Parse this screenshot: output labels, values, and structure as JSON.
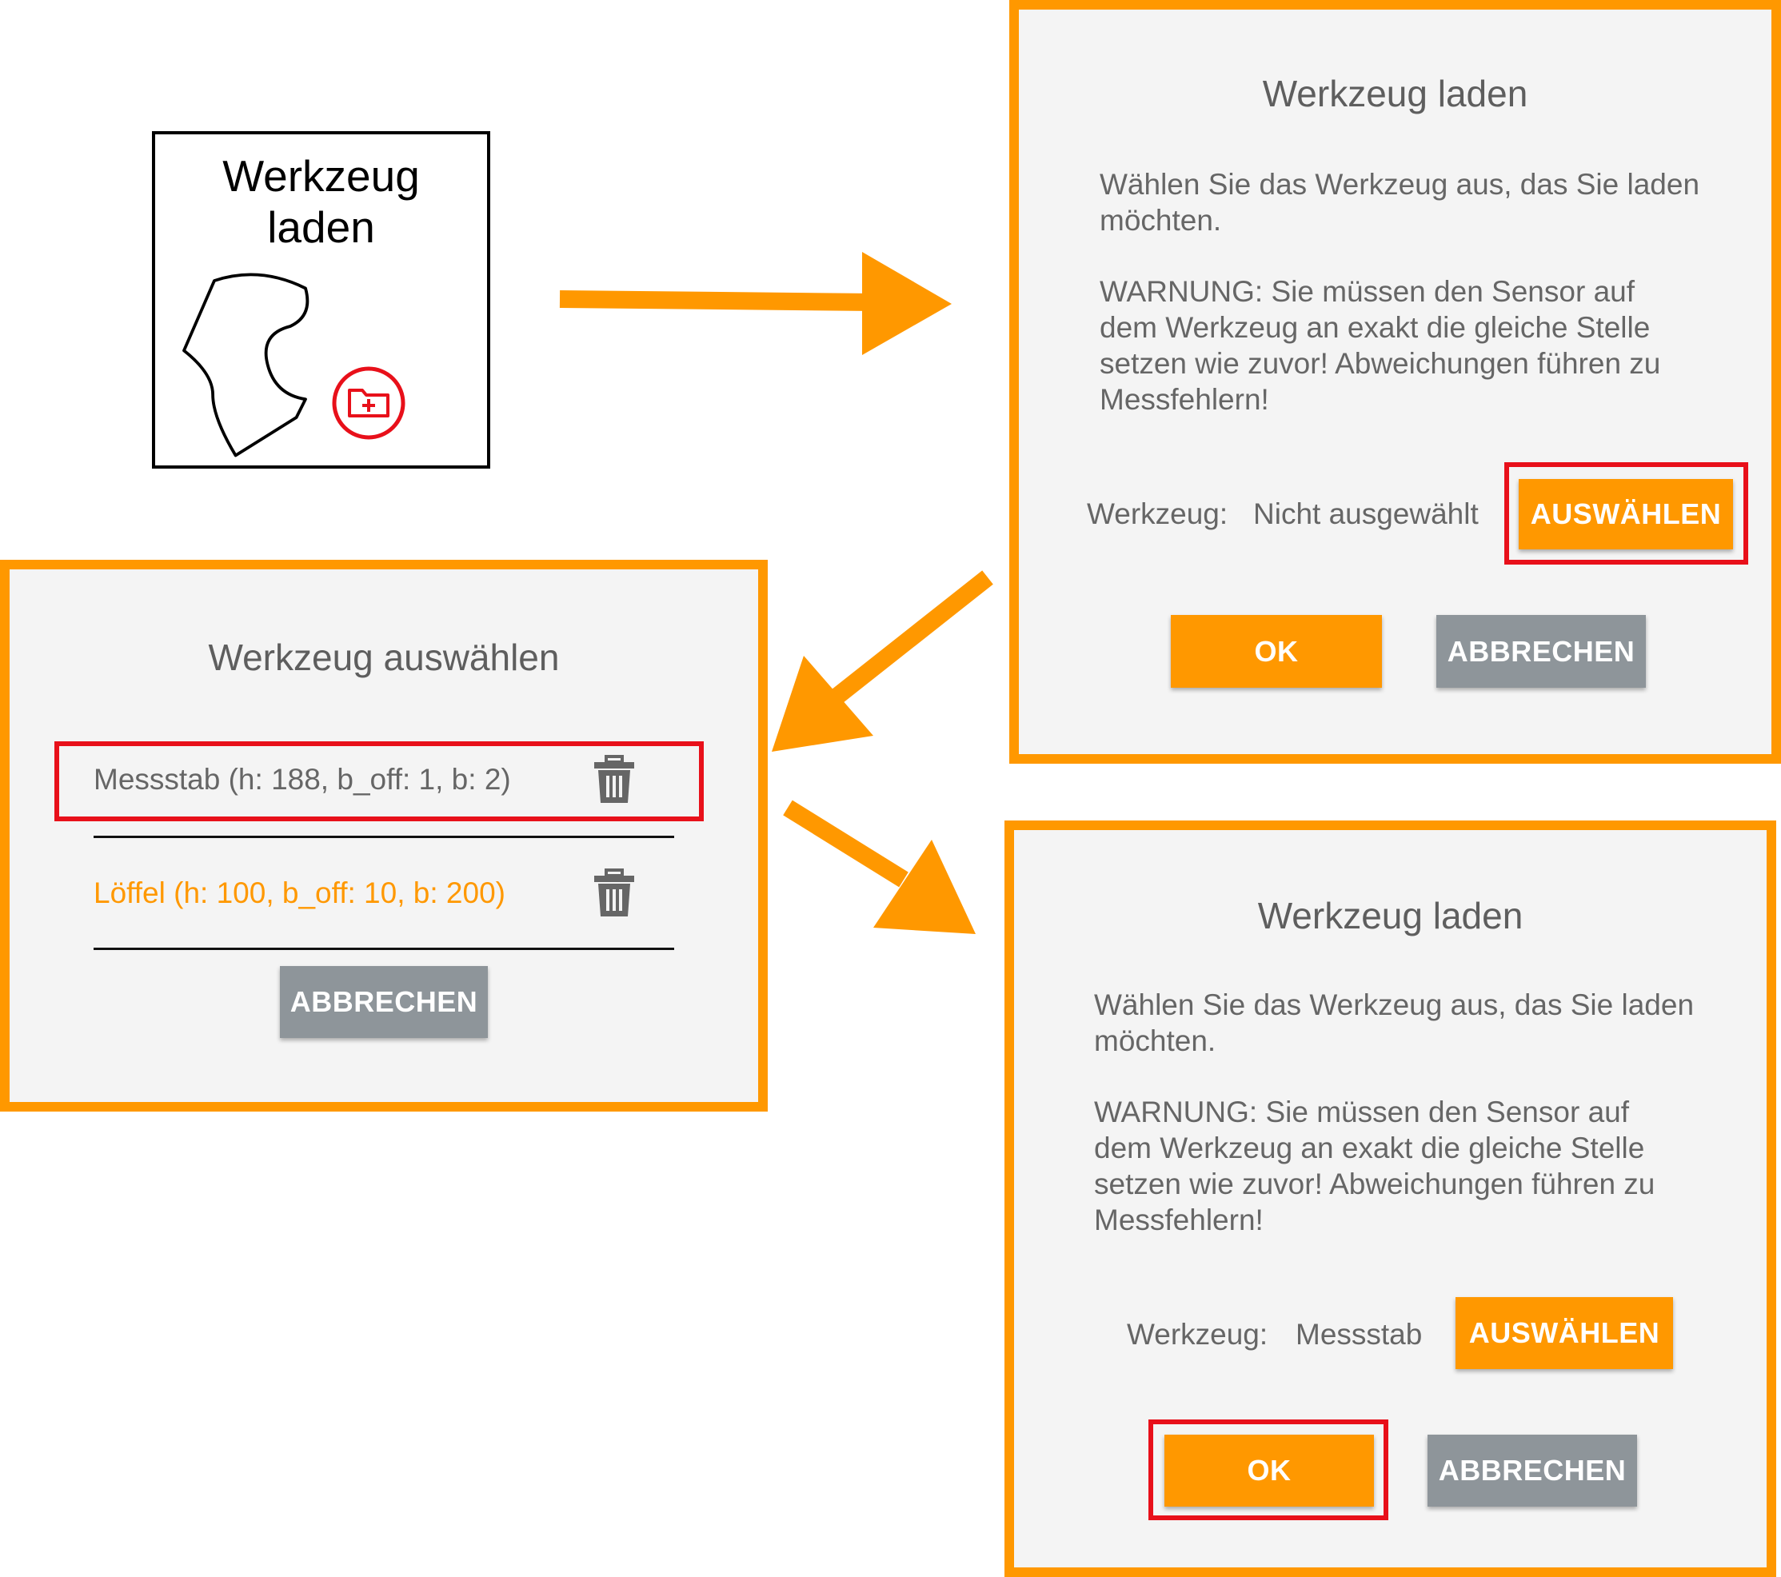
{
  "tile": {
    "title_line1": "Werkzeug",
    "title_line2": "laden",
    "icon": "tool-load-icon",
    "badge_icon": "folder-plus-icon"
  },
  "dialog_load_initial": {
    "title": "Werkzeug laden",
    "description": "Wählen Sie das Werkzeug aus, das Sie laden\nmöchten.",
    "warning": "WARNUNG: Sie müssen den Sensor auf\ndem Werkzeug an exakt die gleiche Stelle\nsetzen wie zuvor! Abweichungen führen zu\nMessfehlern!",
    "tool_label": "Werkzeug:",
    "tool_value": "Nicht ausgewählt",
    "select_button": "AUSWÄHLEN",
    "ok_button": "OK",
    "cancel_button": "ABBRECHEN"
  },
  "dialog_select": {
    "title": "Werkzeug auswählen",
    "items": [
      {
        "label": "Messstab (h: 188, b_off: 1, b: 2)",
        "icon": "trash-icon"
      },
      {
        "label": "Löffel (h: 100, b_off: 10, b: 200)",
        "icon": "trash-icon"
      }
    ],
    "cancel_button": "ABBRECHEN"
  },
  "dialog_load_selected": {
    "title": "Werkzeug laden",
    "description": "Wählen Sie das Werkzeug aus, das Sie laden\nmöchten.",
    "warning": "WARNUNG: Sie müssen den Sensor auf\ndem Werkzeug an exakt die gleiche Stelle\nsetzen wie zuvor! Abweichungen führen zu\nMessfehlern!",
    "tool_label": "Werkzeug:",
    "tool_value": "Messstab",
    "select_button": "AUSWÄHLEN",
    "ok_button": "OK",
    "cancel_button": "ABBRECHEN"
  },
  "colors": {
    "accent": "#ff9800",
    "highlight": "#e8101a",
    "neutral_button": "#8e959a",
    "panel_bg": "#f4f4f4",
    "selected_item_text": "#ff9800"
  }
}
